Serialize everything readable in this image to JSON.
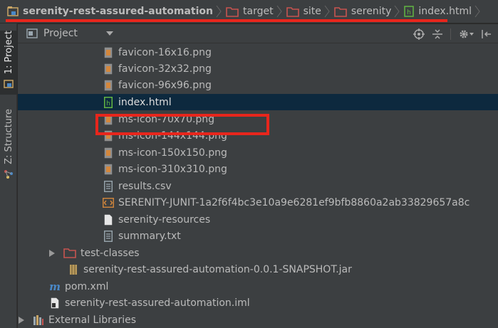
{
  "breadcrumb": {
    "items": [
      {
        "label": "serenity-rest-assured-automation",
        "icon": "project-module-icon"
      },
      {
        "label": "target",
        "icon": "folder-icon"
      },
      {
        "label": "site",
        "icon": "folder-icon"
      },
      {
        "label": "serenity",
        "icon": "folder-icon"
      },
      {
        "label": "index.html",
        "icon": "html-file-icon"
      }
    ]
  },
  "sidebar": {
    "tabs": [
      {
        "label": "1: Project",
        "icon": "project-icon",
        "active": true
      },
      {
        "label": "Z: Structure",
        "icon": "structure-icon",
        "active": false
      }
    ]
  },
  "panel": {
    "title": "Project",
    "actions": [
      "locate-icon",
      "collapse-all-icon",
      "settings-gear-icon",
      "hide-panel-icon"
    ]
  },
  "tree": {
    "rows": [
      {
        "label": "favicon-16x16.png",
        "icon": "image-file-icon"
      },
      {
        "label": "favicon-32x32.png",
        "icon": "image-file-icon"
      },
      {
        "label": "favicon-96x96.png",
        "icon": "image-file-icon"
      },
      {
        "label": "index.html",
        "icon": "html-file-icon",
        "selected": true
      },
      {
        "label": "ms-icon-70x70.png",
        "icon": "image-file-icon"
      },
      {
        "label": "ms-icon-144x144.png",
        "icon": "image-file-icon"
      },
      {
        "label": "ms-icon-150x150.png",
        "icon": "image-file-icon"
      },
      {
        "label": "ms-icon-310x310.png",
        "icon": "image-file-icon"
      },
      {
        "label": "results.csv",
        "icon": "text-file-icon"
      },
      {
        "label": "SERENITY-JUNIT-1a2f6f4bc3e10a9e6281ef9bfb8860a2ab33829657a8c",
        "icon": "xml-file-icon"
      },
      {
        "label": "serenity-resources",
        "icon": "plain-file-icon"
      },
      {
        "label": "summary.txt",
        "icon": "text-file-icon"
      },
      {
        "label": "test-classes",
        "icon": "folder-icon",
        "collapsed": true
      },
      {
        "label": "serenity-rest-assured-automation-0.0.1-SNAPSHOT.jar",
        "icon": "jar-file-icon"
      },
      {
        "label": "pom.xml",
        "icon": "maven-file-icon"
      },
      {
        "label": "serenity-rest-assured-automation.iml",
        "icon": "module-file-icon"
      },
      {
        "label": "External Libraries",
        "icon": "libraries-icon",
        "collapsed": true
      }
    ]
  },
  "colors": {
    "highlight": "#e8261c",
    "selection": "#0d293e",
    "folder": "#c75450",
    "html_file": "#62b543"
  }
}
